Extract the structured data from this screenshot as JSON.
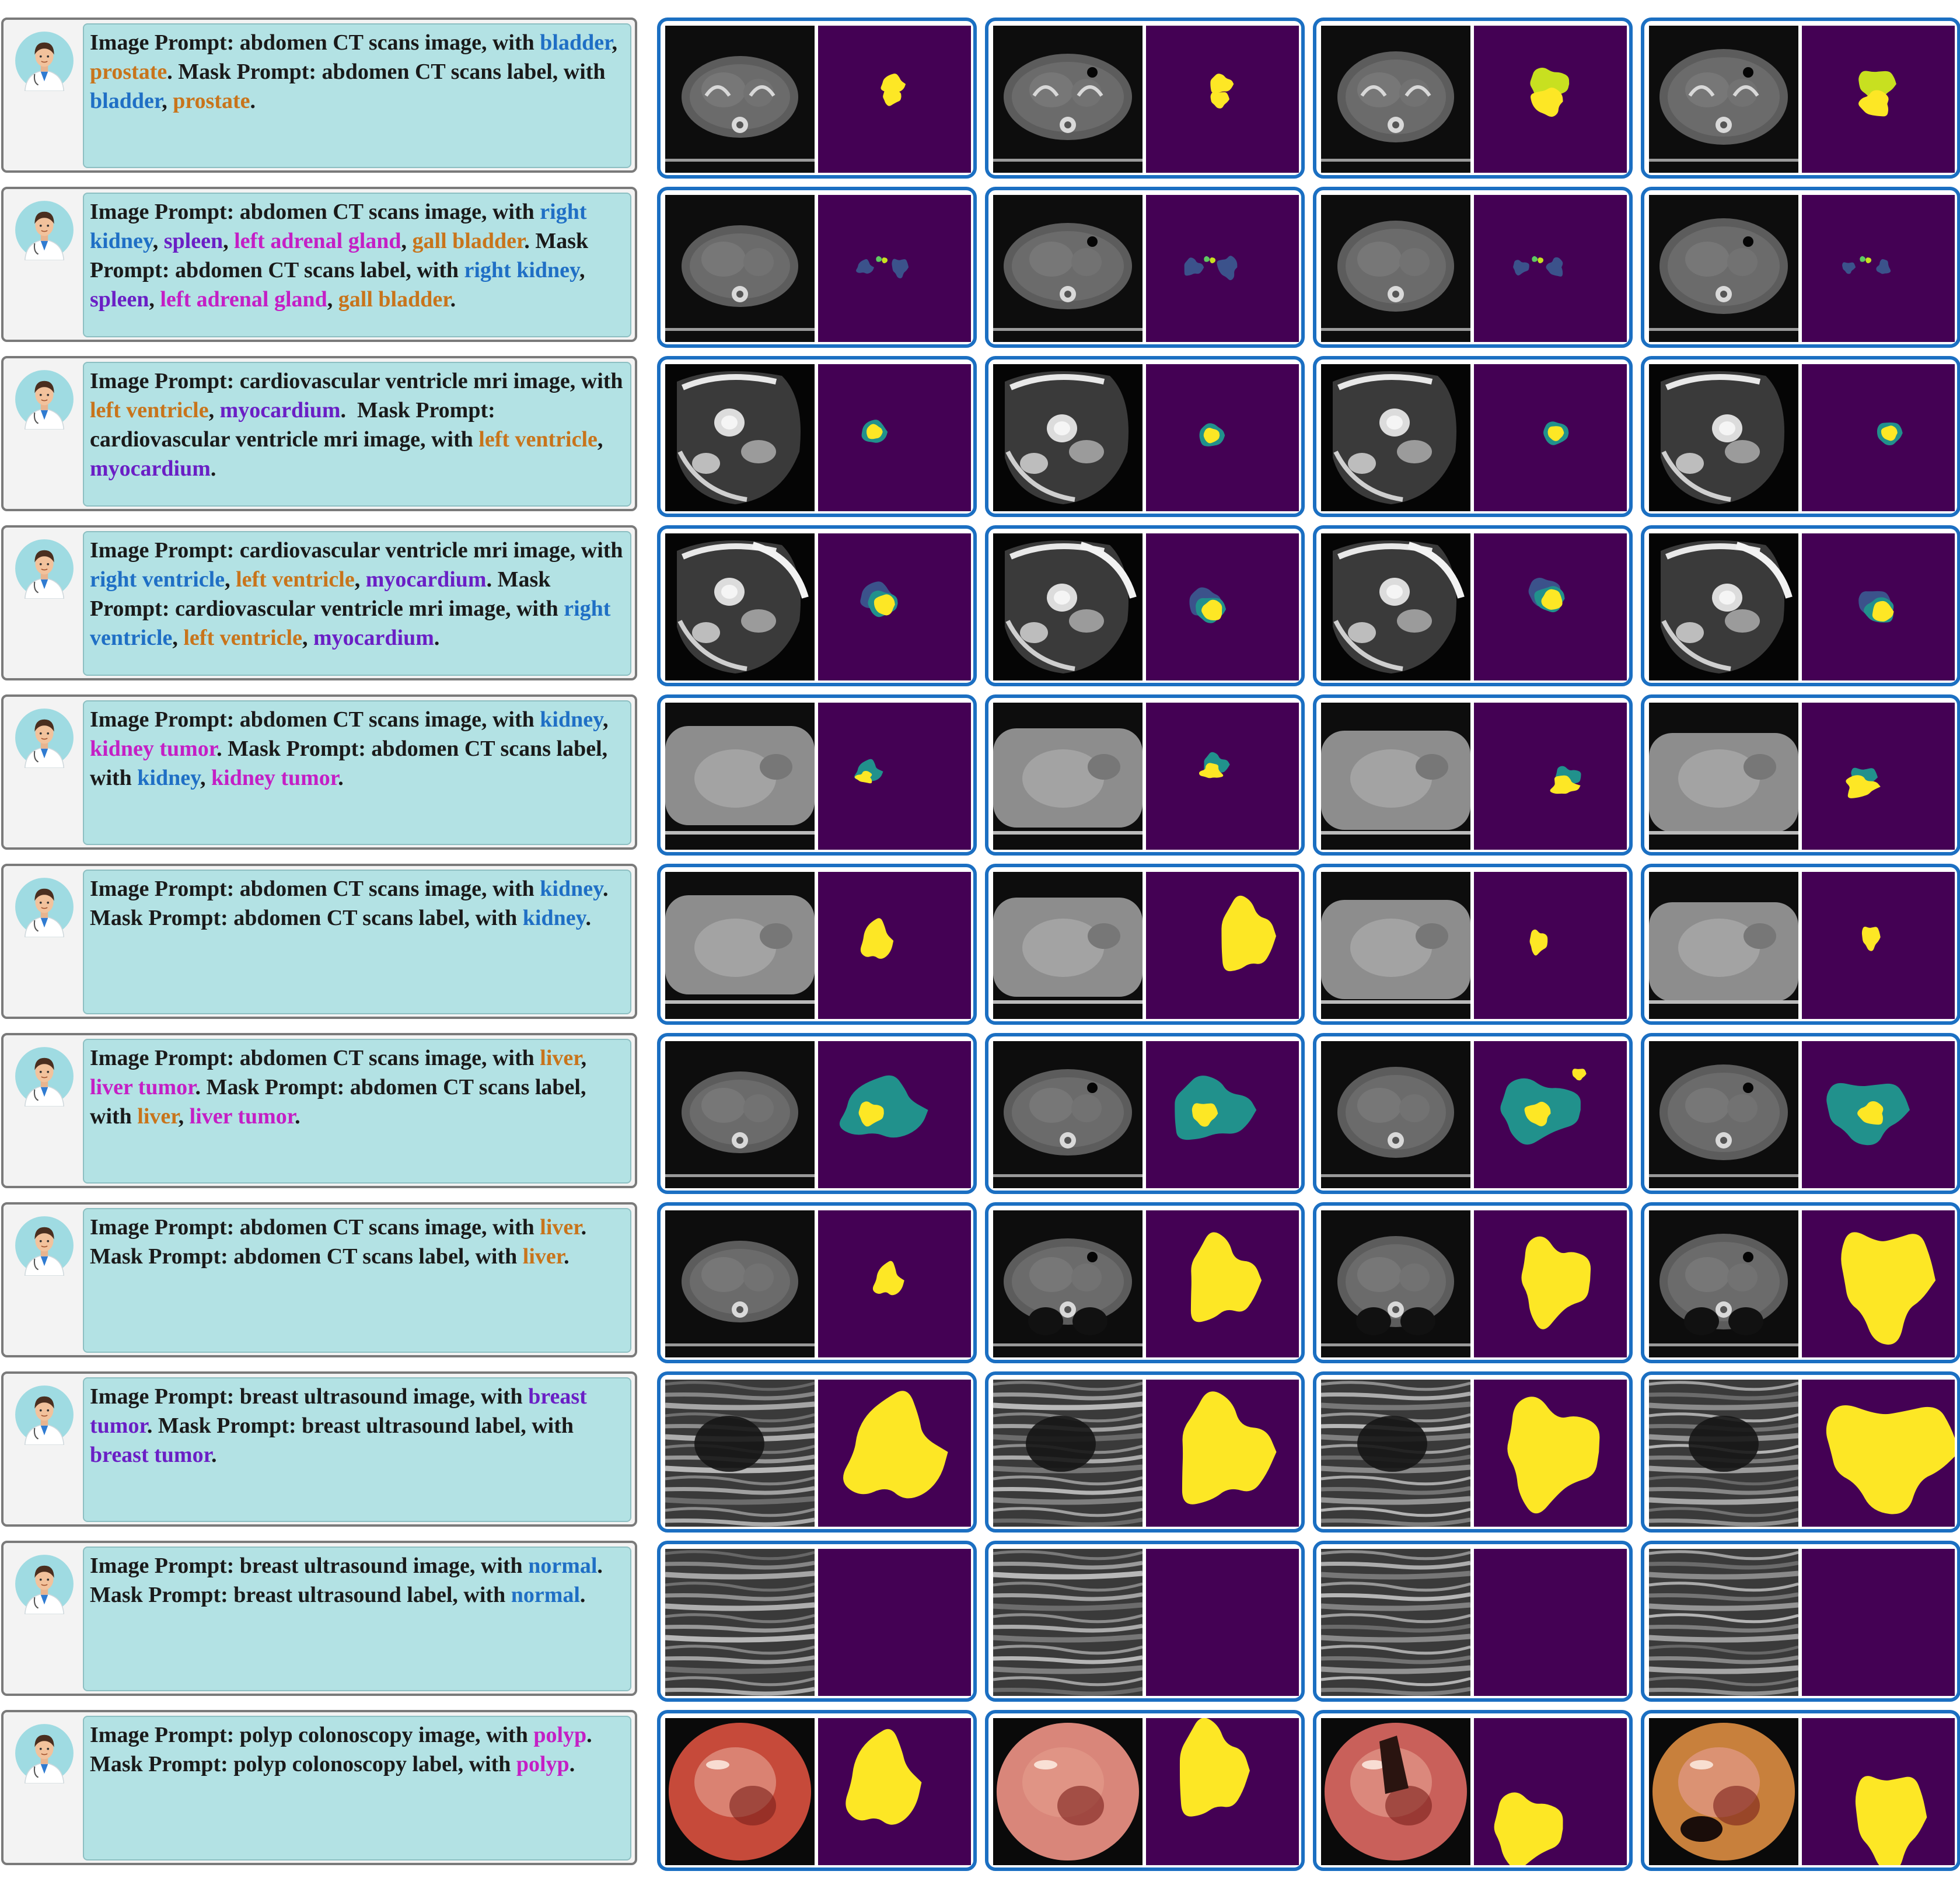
{
  "colors": {
    "bubble_bg": "#b3e2e4",
    "pair_border": "#1b6fc2",
    "mask_bg": "#440154",
    "mask_yellow": "#fde725",
    "mask_teal": "#21918c",
    "mask_blue": "#3b528b",
    "mask_green": "#5ec962",
    "mask_lime": "#c8e020"
  },
  "rows": [
    {
      "modality": "ct",
      "segments": [
        {
          "t": "Image Prompt: abdomen CT scans image, with ",
          "c": "#1a1a1a"
        },
        {
          "t": "bladder",
          "c": "#1f6fc5"
        },
        {
          "t": ", ",
          "c": "#1a1a1a"
        },
        {
          "t": "prostate",
          "c": "#c8741b"
        },
        {
          "t": ". Mask Prompt: abdomen CT scans label, with ",
          "c": "#1a1a1a"
        },
        {
          "t": "bladder",
          "c": "#1f6fc5"
        },
        {
          "t": ", ",
          "c": "#1a1a1a"
        },
        {
          "t": "prostate",
          "c": "#c8741b"
        },
        {
          "t": ".",
          "c": "#1a1a1a"
        }
      ]
    },
    {
      "modality": "ct",
      "segments": [
        {
          "t": "Image Prompt: abdomen CT scans image, with ",
          "c": "#1a1a1a"
        },
        {
          "t": "right kidney",
          "c": "#1f6fc5"
        },
        {
          "t": ", ",
          "c": "#1a1a1a"
        },
        {
          "t": "spleen",
          "c": "#6a1fc5"
        },
        {
          "t": ", ",
          "c": "#1a1a1a"
        },
        {
          "t": "left adrenal gland",
          "c": "#c41fc5"
        },
        {
          "t": ", ",
          "c": "#1a1a1a"
        },
        {
          "t": "gall bladder",
          "c": "#c8741b"
        },
        {
          "t": ". Mask Prompt: abdomen CT scans label, with ",
          "c": "#1a1a1a"
        },
        {
          "t": "right kidney",
          "c": "#1f6fc5"
        },
        {
          "t": ", ",
          "c": "#1a1a1a"
        },
        {
          "t": "spleen",
          "c": "#6a1fc5"
        },
        {
          "t": ", ",
          "c": "#1a1a1a"
        },
        {
          "t": "left adrenal gland",
          "c": "#c41fc5"
        },
        {
          "t": ", ",
          "c": "#1a1a1a"
        },
        {
          "t": "gall bladder",
          "c": "#c8741b"
        },
        {
          "t": ".",
          "c": "#1a1a1a"
        }
      ]
    },
    {
      "modality": "mri",
      "segments": [
        {
          "t": "Image Prompt: cardiovascular ventricle mri image, with ",
          "c": "#1a1a1a"
        },
        {
          "t": "left ventricle",
          "c": "#c8741b"
        },
        {
          "t": ", ",
          "c": "#1a1a1a"
        },
        {
          "t": "myocardium",
          "c": "#6a1fc5"
        },
        {
          "t": ".  Mask Prompt: cardiovascular ventricle mri image, with ",
          "c": "#1a1a1a"
        },
        {
          "t": "left ventricle",
          "c": "#c8741b"
        },
        {
          "t": ", ",
          "c": "#1a1a1a"
        },
        {
          "t": "myocardium",
          "c": "#6a1fc5"
        },
        {
          "t": ".",
          "c": "#1a1a1a"
        }
      ]
    },
    {
      "modality": "mri",
      "segments": [
        {
          "t": "Image Prompt: cardiovascular ventricle mri image, with ",
          "c": "#1a1a1a"
        },
        {
          "t": "right ventricle",
          "c": "#1f6fc5"
        },
        {
          "t": ", ",
          "c": "#1a1a1a"
        },
        {
          "t": "left ventricle",
          "c": "#c8741b"
        },
        {
          "t": ", ",
          "c": "#1a1a1a"
        },
        {
          "t": "myocardium",
          "c": "#6a1fc5"
        },
        {
          "t": ". Mask Prompt: cardiovascular ventricle mri image, with ",
          "c": "#1a1a1a"
        },
        {
          "t": "right ventricle",
          "c": "#1f6fc5"
        },
        {
          "t": ", ",
          "c": "#1a1a1a"
        },
        {
          "t": "left ventricle",
          "c": "#c8741b"
        },
        {
          "t": ", ",
          "c": "#1a1a1a"
        },
        {
          "t": "myocardium",
          "c": "#6a1fc5"
        },
        {
          "t": ".",
          "c": "#1a1a1a"
        }
      ]
    },
    {
      "modality": "ct",
      "segments": [
        {
          "t": "Image Prompt: abdomen CT scans image, with ",
          "c": "#1a1a1a"
        },
        {
          "t": "kidney",
          "c": "#1f6fc5"
        },
        {
          "t": ", ",
          "c": "#1a1a1a"
        },
        {
          "t": "kidney tumor",
          "c": "#c41fc5"
        },
        {
          "t": ". Mask Prompt: abdomen CT scans label, with ",
          "c": "#1a1a1a"
        },
        {
          "t": "kidney",
          "c": "#1f6fc5"
        },
        {
          "t": ", ",
          "c": "#1a1a1a"
        },
        {
          "t": "kidney tumor",
          "c": "#c41fc5"
        },
        {
          "t": ".",
          "c": "#1a1a1a"
        }
      ]
    },
    {
      "modality": "ct",
      "segments": [
        {
          "t": "Image Prompt: abdomen CT scans image, with ",
          "c": "#1a1a1a"
        },
        {
          "t": "kidney",
          "c": "#1f6fc5"
        },
        {
          "t": ". Mask Prompt: abdomen CT scans label, with ",
          "c": "#1a1a1a"
        },
        {
          "t": "kidney",
          "c": "#1f6fc5"
        },
        {
          "t": ".",
          "c": "#1a1a1a"
        }
      ]
    },
    {
      "modality": "ct",
      "segments": [
        {
          "t": "Image Prompt: abdomen CT scans image, with ",
          "c": "#1a1a1a"
        },
        {
          "t": "liver",
          "c": "#c8741b"
        },
        {
          "t": ", ",
          "c": "#1a1a1a"
        },
        {
          "t": "liver tumor",
          "c": "#c41fc5"
        },
        {
          "t": ". Mask Prompt: abdomen CT scans label, with ",
          "c": "#1a1a1a"
        },
        {
          "t": "liver",
          "c": "#c8741b"
        },
        {
          "t": ", ",
          "c": "#1a1a1a"
        },
        {
          "t": "liver tumor",
          "c": "#c41fc5"
        },
        {
          "t": ".",
          "c": "#1a1a1a"
        }
      ]
    },
    {
      "modality": "ct",
      "segments": [
        {
          "t": "Image Prompt: abdomen CT scans image, with ",
          "c": "#1a1a1a"
        },
        {
          "t": "liver",
          "c": "#c8741b"
        },
        {
          "t": ". Mask Prompt: abdomen CT scans label, with ",
          "c": "#1a1a1a"
        },
        {
          "t": "liver",
          "c": "#c8741b"
        },
        {
          "t": ".",
          "c": "#1a1a1a"
        }
      ]
    },
    {
      "modality": "us",
      "segments": [
        {
          "t": "Image Prompt: breast ultrasound image, with ",
          "c": "#1a1a1a"
        },
        {
          "t": "breast tumor",
          "c": "#6a1fc5"
        },
        {
          "t": ". Mask Prompt: breast ultrasound label, with ",
          "c": "#1a1a1a"
        },
        {
          "t": "breast tumor",
          "c": "#6a1fc5"
        },
        {
          "t": ".",
          "c": "#1a1a1a"
        }
      ]
    },
    {
      "modality": "us",
      "segments": [
        {
          "t": "Image Prompt: breast ultrasound image, with ",
          "c": "#1a1a1a"
        },
        {
          "t": "normal",
          "c": "#1f6fc5"
        },
        {
          "t": ". Mask Prompt: breast ultrasound label, with ",
          "c": "#1a1a1a"
        },
        {
          "t": "normal",
          "c": "#1f6fc5"
        },
        {
          "t": ".",
          "c": "#1a1a1a"
        }
      ]
    },
    {
      "modality": "endo",
      "segments": [
        {
          "t": "Image Prompt: polyp colonoscopy image, with ",
          "c": "#1a1a1a"
        },
        {
          "t": "polyp",
          "c": "#c41fc5"
        },
        {
          "t": ". Mask Prompt: polyp colonoscopy label, with ",
          "c": "#1a1a1a"
        },
        {
          "t": "polyp",
          "c": "#c41fc5"
        },
        {
          "t": ".",
          "c": "#1a1a1a"
        }
      ]
    }
  ]
}
